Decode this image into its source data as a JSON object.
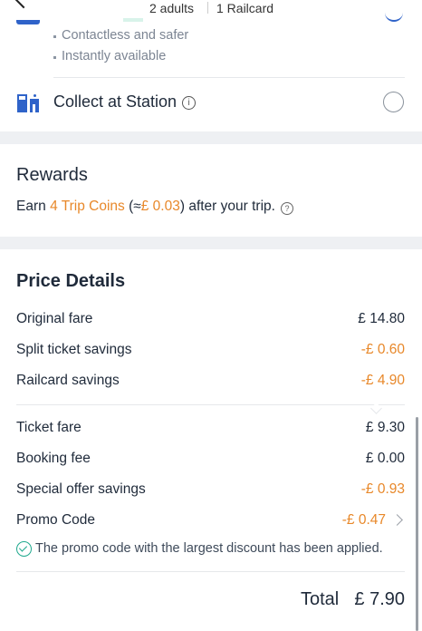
{
  "header": {
    "passengers": "2 adults",
    "railcard": "1 Railcard"
  },
  "delivery": {
    "bullets": [
      "Contactless and safer",
      "Instantly available"
    ],
    "collect_label": "Collect at Station"
  },
  "rewards": {
    "title": "Rewards",
    "prefix": "Earn ",
    "coins": "4 Trip Coins",
    "approx_open": " (≈",
    "approx_value": "£ 0.03",
    "suffix": ") after your trip."
  },
  "price_details": {
    "title": "Price Details",
    "rows": [
      {
        "label": "Original fare",
        "value": "£ 14.80"
      },
      {
        "label": "Split ticket savings",
        "value": "-£ 0.60"
      },
      {
        "label": "Railcard savings",
        "value": "-£ 4.90"
      },
      {
        "label": "Ticket fare",
        "value": "£ 9.30"
      },
      {
        "label": "Booking fee",
        "value": "£ 0.00"
      },
      {
        "label": "Special offer savings",
        "value": "-£ 0.93"
      },
      {
        "label": "Promo Code",
        "value": "-£ 0.47"
      }
    ],
    "promo_note": "The promo code with the largest discount has been applied.",
    "total_label": "Total",
    "total_value": "£ 7.90"
  },
  "colors": {
    "accent_blue": "#2f63c9",
    "savings_orange": "#e8882a",
    "success_green": "#1ea88d"
  }
}
